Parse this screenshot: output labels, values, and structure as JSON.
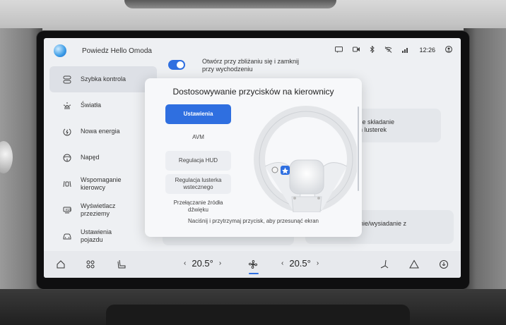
{
  "status_bar": {
    "assistant_prompt": "Powiedz Hello Omoda",
    "clock": "12:26",
    "icons": [
      "message-icon",
      "record-icon",
      "bluetooth-icon",
      "wifi-off-icon",
      "signal-icon",
      "user-icon"
    ]
  },
  "sidebar": {
    "items": [
      {
        "label": "Szybka kontrola",
        "icon": "quick-control-icon",
        "active": true
      },
      {
        "label": "Światła",
        "icon": "light-icon",
        "active": false
      },
      {
        "label": "Nowa energia",
        "icon": "energy-icon",
        "active": false
      },
      {
        "label": "Napęd",
        "icon": "steering-icon",
        "active": false
      },
      {
        "label": "Wspomaganie kierowcy",
        "icon": "driver-assist-icon",
        "active": false
      },
      {
        "label": "Wyświetlacz przeziemy",
        "icon": "display-icon",
        "active": false
      },
      {
        "label": "Ustawienia pojazdu",
        "icon": "car-icon",
        "active": false
      }
    ]
  },
  "background": {
    "toggle_label": "Otwórz przy zbliżaniu się i zamknij przy wychodzeniu",
    "mirror_fold_text": "yczne składanie\nnych lusterek",
    "entry_exit_text": "iadanie/wysiadanie z"
  },
  "modal": {
    "title": "Dostosowywanie przycisków na kierownicy",
    "options": [
      {
        "label": "Ustawienia",
        "style": "selected"
      },
      {
        "label": "AVM",
        "style": "plain"
      },
      {
        "label": "Regulacja HUD",
        "style": "card"
      },
      {
        "label": "Regulacja lusterka wstecznego",
        "style": "card"
      },
      {
        "label": "Przełączanie źródła dźwięku",
        "style": "plain"
      }
    ],
    "hint": "Naciśnij i przytrzymaj przycisk, aby przesunąć ekran"
  },
  "dock": {
    "temp_left": "20.5°",
    "temp_right": "20.5°",
    "icons": [
      "home-icon",
      "apps-icon",
      "seat-icon",
      "fan-icon",
      "seat-heat-icon",
      "warning-icon",
      "assistant-icon"
    ]
  },
  "colors": {
    "accent": "#2f6fe0",
    "screen_bg": "#eef0f3",
    "active_item_bg": "#dde0e6"
  }
}
